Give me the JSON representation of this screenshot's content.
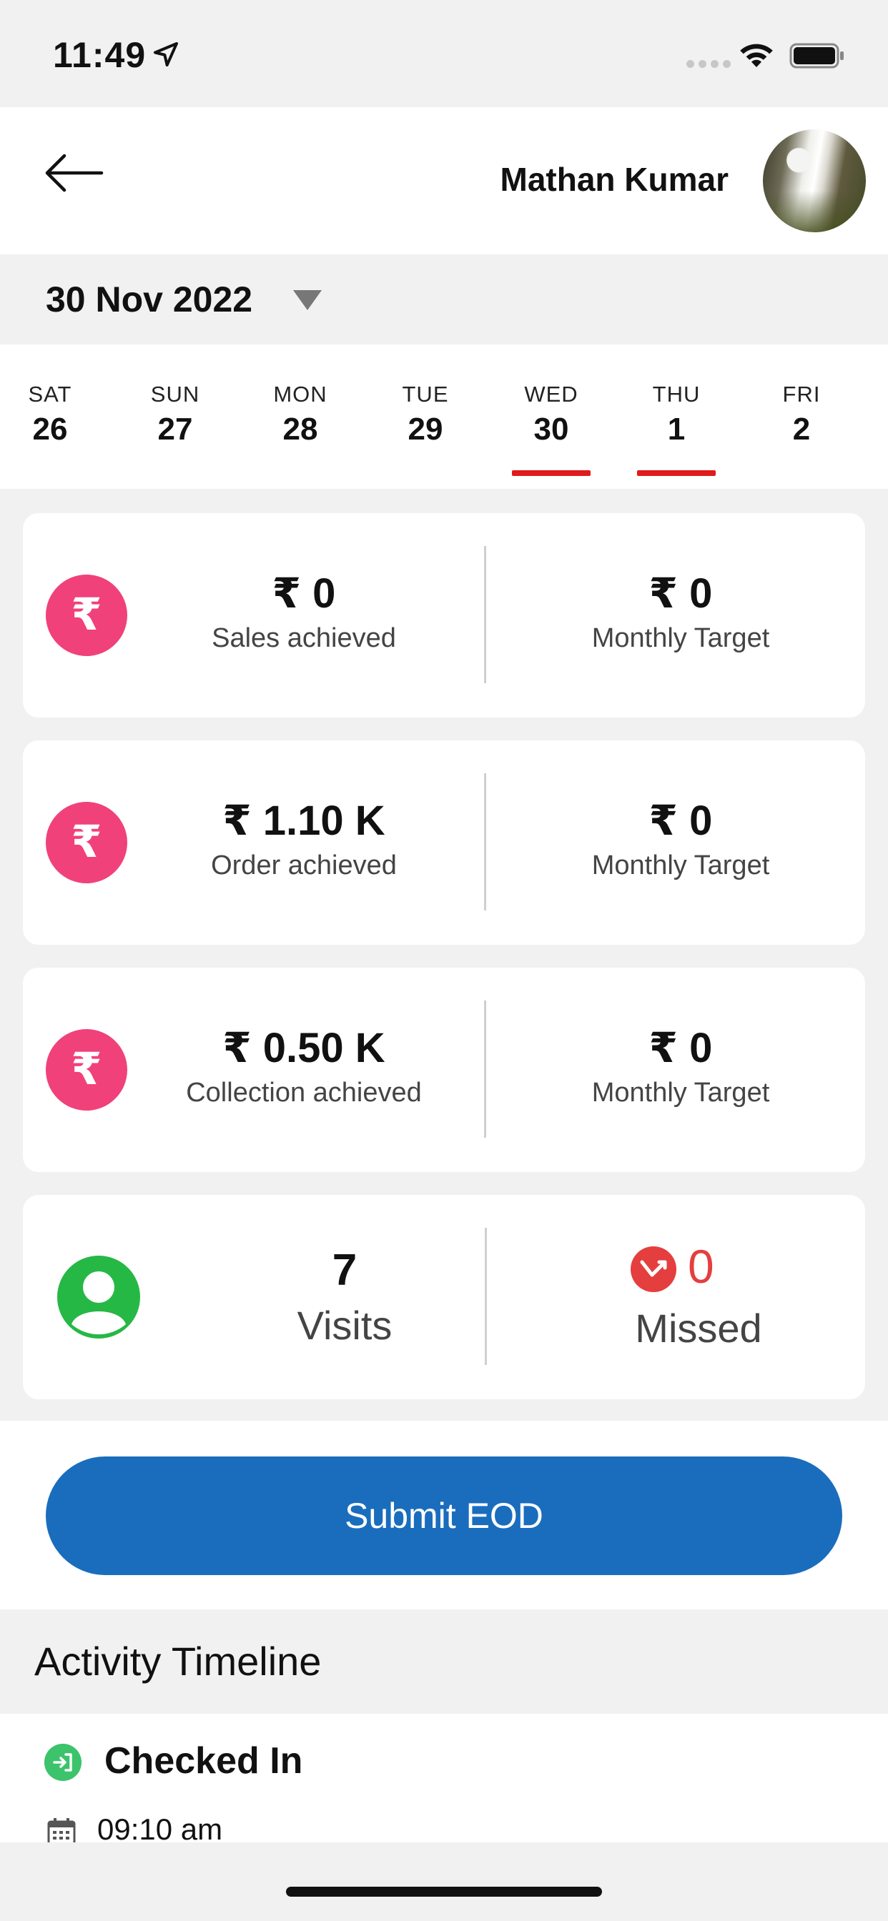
{
  "status_bar": {
    "time": "11:49",
    "icons": [
      "location-arrow-icon",
      "signal-dots-icon",
      "wifi-icon",
      "battery-icon"
    ]
  },
  "header": {
    "back_icon": "arrow-left-icon",
    "user_name": "Mathan Kumar",
    "avatar": "waterfall-photo"
  },
  "date_picker": {
    "selected_date": "30 Nov 2022",
    "caret_icon": "caret-down-icon"
  },
  "week": [
    {
      "day": "SAT",
      "date": "26",
      "underlined": false
    },
    {
      "day": "SUN",
      "date": "27",
      "underlined": false
    },
    {
      "day": "MON",
      "date": "28",
      "underlined": false
    },
    {
      "day": "TUE",
      "date": "29",
      "underlined": false
    },
    {
      "day": "WED",
      "date": "30",
      "underlined": true
    },
    {
      "day": "THU",
      "date": "1",
      "underlined": true
    },
    {
      "day": "FRI",
      "date": "2",
      "underlined": false
    }
  ],
  "cards": {
    "sales": {
      "icon_glyph": "₹",
      "value": "₹ 0",
      "label": "Sales achieved",
      "target_value": "₹ 0",
      "target_label": "Monthly Target"
    },
    "order": {
      "icon_glyph": "₹",
      "value": "₹ 1.10 K",
      "label": "Order achieved",
      "target_value": "₹ 0",
      "target_label": "Monthly Target"
    },
    "collection": {
      "icon_glyph": "₹",
      "value": "₹ 0.50 K",
      "label": "Collection achieved",
      "target_value": "₹ 0",
      "target_label": "Monthly Target"
    },
    "visits": {
      "value": "7",
      "label": "Visits",
      "missed_value": "0",
      "missed_label": "Missed"
    }
  },
  "submit_button": {
    "label": "Submit EOD"
  },
  "timeline": {
    "title": "Activity Timeline",
    "entries": [
      {
        "label": "Checked In",
        "time": "09:10 am"
      }
    ]
  },
  "colors": {
    "accent_pink": "#f0417b",
    "accent_blue": "#1a6dbd",
    "underline_red": "#e01b1b",
    "visits_green": "#26b845",
    "missed_red": "#e53e3e",
    "checkin_green": "#3cc36b"
  }
}
